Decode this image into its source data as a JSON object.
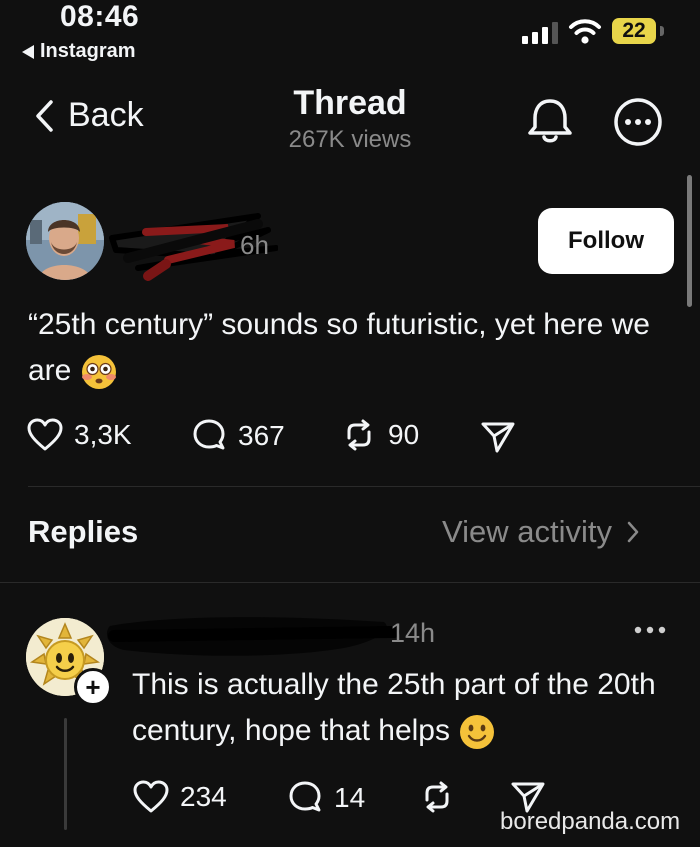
{
  "status_bar": {
    "time": "08:46",
    "back_app": "Instagram",
    "battery": "22"
  },
  "header": {
    "back_label": "Back",
    "title": "Thread",
    "views": "267K views"
  },
  "post": {
    "author_time_fragment": "6h",
    "follow_label": "Follow",
    "text": "“25th century” sounds so futuristic, yet here we are",
    "emoji": "flushed-face",
    "likes": "3,3K",
    "comments": "367",
    "reposts": "90"
  },
  "replies_section": {
    "label": "Replies",
    "view_activity": "View activity"
  },
  "reply": {
    "time": "14h",
    "text": "This is actually the 25th part of the 20th century, hope that helps",
    "emoji": "slightly-smiling-face",
    "likes": "234",
    "comments": "14"
  },
  "watermark": "boredpanda.com",
  "colors": {
    "background": "#101010",
    "text": "#f3f5f7",
    "muted": "#8a8a8a",
    "battery": "#e8d54a"
  }
}
